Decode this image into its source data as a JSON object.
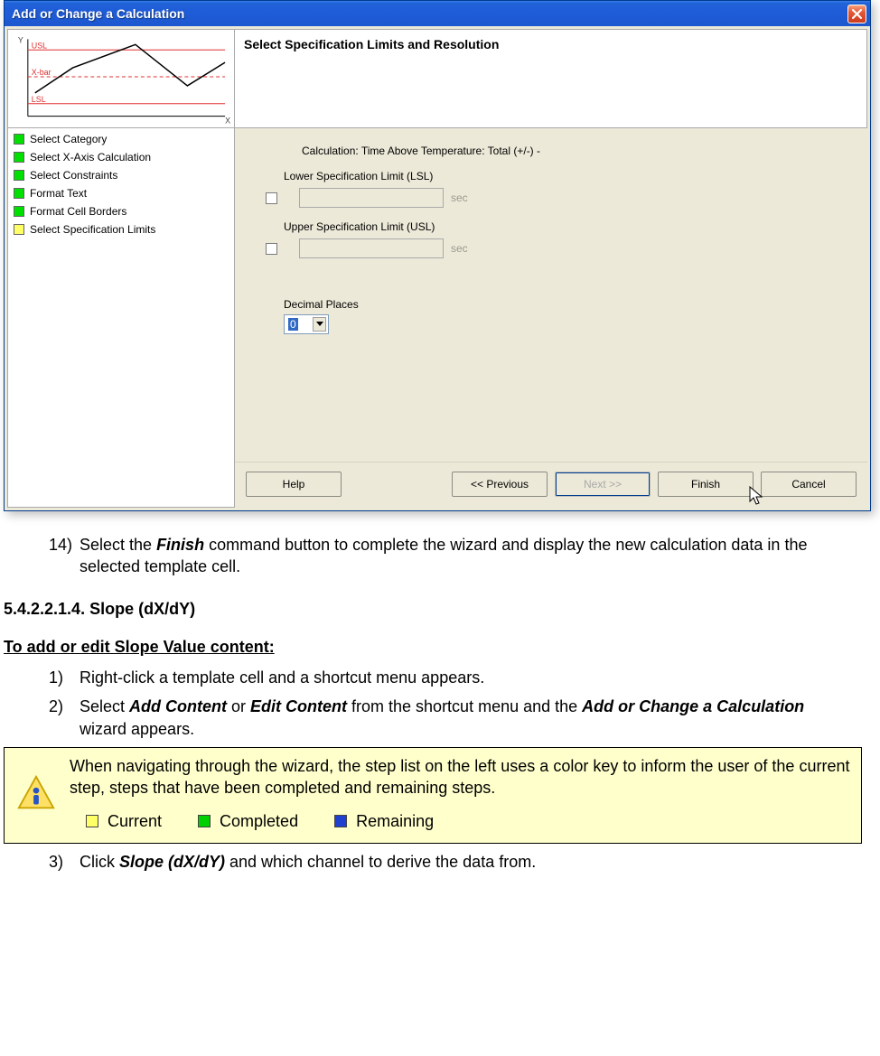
{
  "dialog": {
    "title": "Add or Change a Calculation",
    "panelHeader": "Select Specification Limits and Resolution",
    "calcLabel": "Calculation: Time Above Temperature: Total (+/-) -",
    "lslLabel": "Lower Specification Limit (LSL)",
    "uslLabel": "Upper Specification Limit (USL)",
    "unitLsl": "sec",
    "unitUsl": "sec",
    "decPlacesLabel": "Decimal Places",
    "decValue": "0",
    "steps": [
      {
        "label": "Select Category",
        "state": "green"
      },
      {
        "label": "Select X-Axis Calculation",
        "state": "green"
      },
      {
        "label": "Select Constraints",
        "state": "green"
      },
      {
        "label": "Format Text",
        "state": "green"
      },
      {
        "label": "Format Cell Borders",
        "state": "green"
      },
      {
        "label": "Select Specification Limits",
        "state": "yellow"
      }
    ],
    "buttons": {
      "help": "Help",
      "prev": "<< Previous",
      "next": "Next >>",
      "finish": "Finish",
      "cancel": "Cancel"
    },
    "chartLabels": {
      "y": "Y",
      "x": "X",
      "usl": "USL",
      "xbar": "X-bar",
      "lsl": "LSL"
    }
  },
  "doc": {
    "step14_num": "14)",
    "step14_a": "Select the ",
    "step14_bi": "Finish",
    "step14_b": " command button to complete the wizard and display the new calculation data in the selected template cell.",
    "sectionNumHeading": "5.4.2.2.1.4. Slope (dX/dY)",
    "subHeading": "To add or edit Slope Value content:",
    "s1_num": "1)",
    "s1": "Right-click a template cell and a shortcut menu appears.",
    "s2_num": "2)",
    "s2_a": "Select ",
    "s2_bi1": "Add Content",
    "s2_mid": " or ",
    "s2_bi2": "Edit Content",
    "s2_b": " from the shortcut menu and the ",
    "s2_bi3": "Add or Change a Calculation",
    "s2_c": " wizard appears.",
    "noteText": "When navigating through the wizard, the step list on the left uses a color key to inform the user of the current step, steps that have been completed and remaining steps.",
    "key": {
      "current": "Current",
      "completed": "Completed",
      "remaining": "Remaining"
    },
    "s3_num": "3)",
    "s3_a": "Click ",
    "s3_bi": "Slope (dX/dY)",
    "s3_b": " and which channel to derive the data from."
  }
}
